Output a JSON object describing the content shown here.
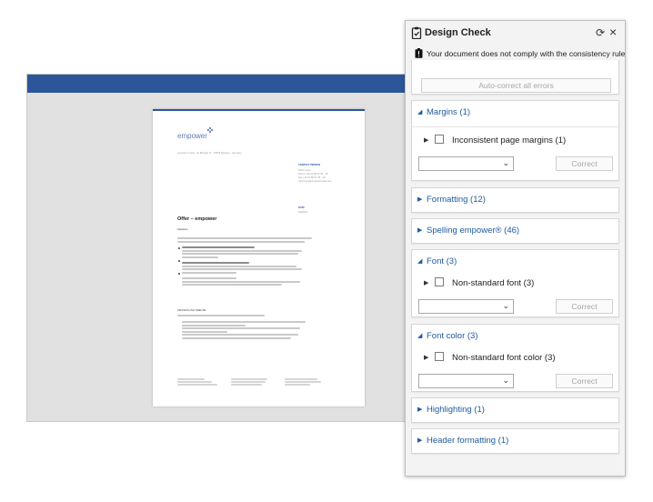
{
  "panel": {
    "title": "Design Check",
    "status": "Your document does not comply with the consistency rules.",
    "autocorrect_label": "Auto-correct all errors",
    "sections": [
      {
        "label": "Margins (1)",
        "expanded": true,
        "item": "Inconsistent page margins (1)",
        "button": "Correct"
      },
      {
        "label": "Formatting (12)",
        "expanded": false
      },
      {
        "label": "Spelling empower® (46)",
        "expanded": false
      },
      {
        "label": "Font (3)",
        "expanded": true,
        "item": "Non-standard font (3)",
        "button": "Correct"
      },
      {
        "label": "Font color (3)",
        "expanded": true,
        "item": "Non-standard font color (3)",
        "button": "Correct"
      },
      {
        "label": "Highlighting (1)",
        "expanded": false
      },
      {
        "label": "Header formatting (1)",
        "expanded": false
      }
    ],
    "icons": {
      "header": "clipboard-check-icon",
      "refresh": "refresh-icon",
      "close": "close-icon",
      "warning": "clipboard-warning-icon"
    }
  },
  "document": {
    "logo": "empower",
    "address_line": "empower GmbH · An Beispiel 13 · 45678 Dokgrun · Germany",
    "contact_heading": "CONTACT PERSON",
    "contact_lines": [
      "Robin Haus",
      "Phone +49 (0) 88 67 95 - 15",
      "Fax +49 (0) 88 67 95 - 10",
      "robin.haus@empowersuite.com"
    ],
    "date_heading": "DATE",
    "date": "6/9/2022",
    "heading": "Offer – empower",
    "salutation": "Salutation,",
    "process_heading": "PROCESS AND TIMELINE",
    "colors": {
      "accent": "#2b579a",
      "link": "#1f5a9e"
    }
  }
}
